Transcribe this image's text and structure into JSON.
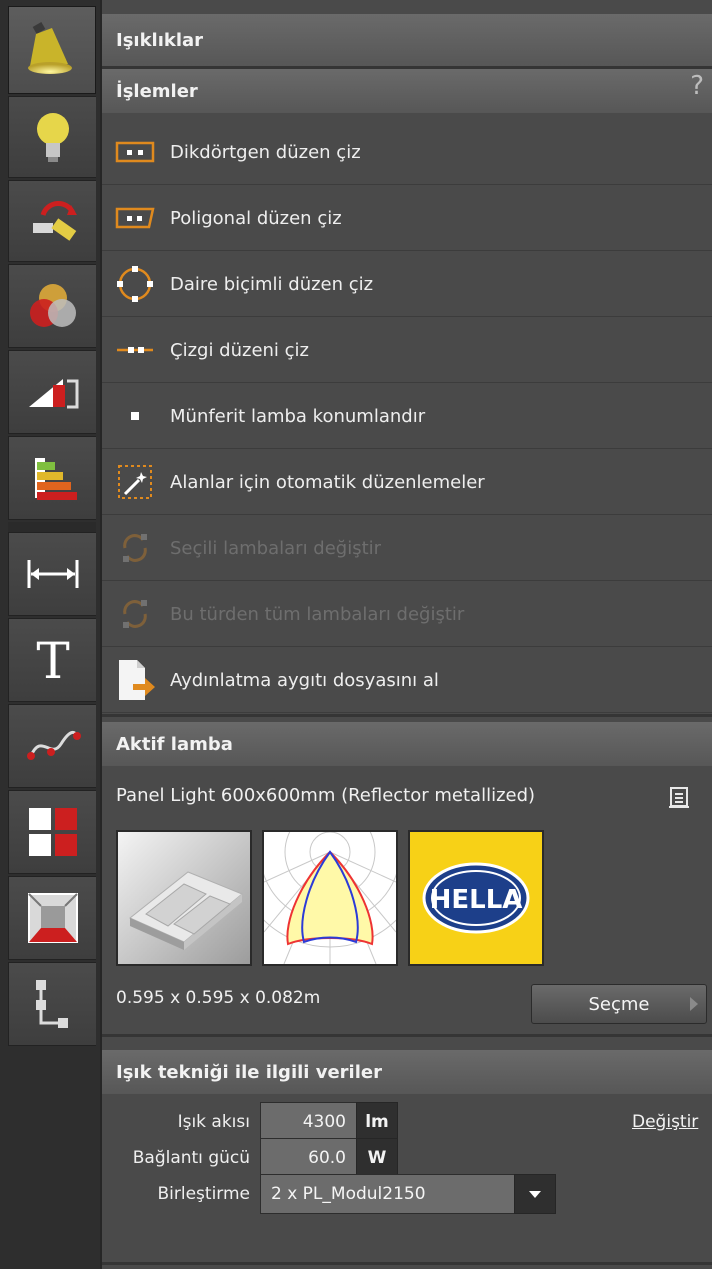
{
  "panel": {
    "title": "Işıklıklar",
    "actions_header": "İşlemler",
    "help_label": "?"
  },
  "actions": [
    {
      "label": "Dikdörtgen düzen çiz",
      "icon": "rectangle-layout-icon",
      "enabled": true
    },
    {
      "label": "Poligonal düzen çiz",
      "icon": "polygon-layout-icon",
      "enabled": true
    },
    {
      "label": "Daire biçimli düzen çiz",
      "icon": "circle-layout-icon",
      "enabled": true
    },
    {
      "label": "Çizgi düzeni çiz",
      "icon": "line-layout-icon",
      "enabled": true
    },
    {
      "label": "Münferit lamba konumlandır",
      "icon": "single-lamp-icon",
      "enabled": true
    },
    {
      "label": "Alanlar için otomatik düzenlemeler",
      "icon": "magic-wand-icon",
      "enabled": true
    },
    {
      "label": "Seçili lambaları değiştir",
      "icon": "replace-selected-icon",
      "enabled": false
    },
    {
      "label": "Bu türden tüm lambaları değiştir",
      "icon": "replace-all-icon",
      "enabled": false
    },
    {
      "label": "Aydınlatma aygıtı dosyasını al",
      "icon": "import-file-icon",
      "enabled": true
    }
  ],
  "active_lamp": {
    "header": "Aktif lamba",
    "name": "Panel Light 600x600mm (Reflector metallized)",
    "dimensions": "0.595 x 0.595 x 0.082m",
    "select_label": "Seçme",
    "brand_logo_text": "HELLA"
  },
  "photometric": {
    "header": "Işık tekniği ile ilgili veriler",
    "flux_label": "Işık akısı",
    "flux_value": "4300",
    "flux_unit": "lm",
    "power_label": "Bağlantı gücü",
    "power_value": "60.0",
    "power_unit": "W",
    "change_link": "Değiştir",
    "combination_label": "Birleştirme",
    "combination_value": "2 x PL_Modul2150"
  },
  "toolbar": [
    "luminaire-icon",
    "bulb-icon",
    "daylight-icon",
    "color-icon",
    "ramp-icon",
    "energy-icon",
    "dimension-icon",
    "text-icon",
    "curve-icon",
    "tiles-icon",
    "room-icon",
    "hierarchy-icon"
  ],
  "colors": {
    "accent_orange": "#e08a1e",
    "accent_red": "#cc1f1f",
    "hella_yellow": "#f7d117",
    "hella_blue": "#1d3f8a"
  }
}
